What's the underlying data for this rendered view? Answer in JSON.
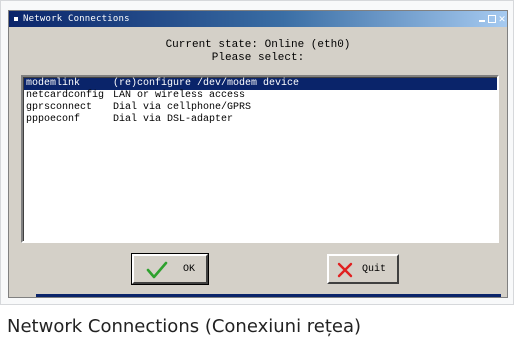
{
  "window": {
    "title": "Network Connections",
    "controls": [
      "minimize",
      "maximize",
      "close"
    ]
  },
  "prompt": {
    "line1": "Current state: Online (eth0)",
    "line2": "Please select:"
  },
  "list": {
    "selected_index": 0,
    "items": [
      {
        "name": "modemlink",
        "description": "(re)configure /dev/modem device"
      },
      {
        "name": "netcardconfig",
        "description": "LAN or wireless access"
      },
      {
        "name": "gprsconnect",
        "description": "Dial via cellphone/GPRS"
      },
      {
        "name": "pppoeconf",
        "description": "Dial via DSL-adapter"
      }
    ]
  },
  "buttons": {
    "ok_label": "OK",
    "quit_label": "Quit"
  },
  "icons": {
    "ok": "check-icon",
    "quit": "x-icon"
  },
  "colors": {
    "titlebar": "#0a246a",
    "selection": "#0a246a",
    "ok_check": "#2ea12e",
    "quit_x": "#e02020"
  },
  "caption": "Network Connections (Conexiuni rețea)"
}
